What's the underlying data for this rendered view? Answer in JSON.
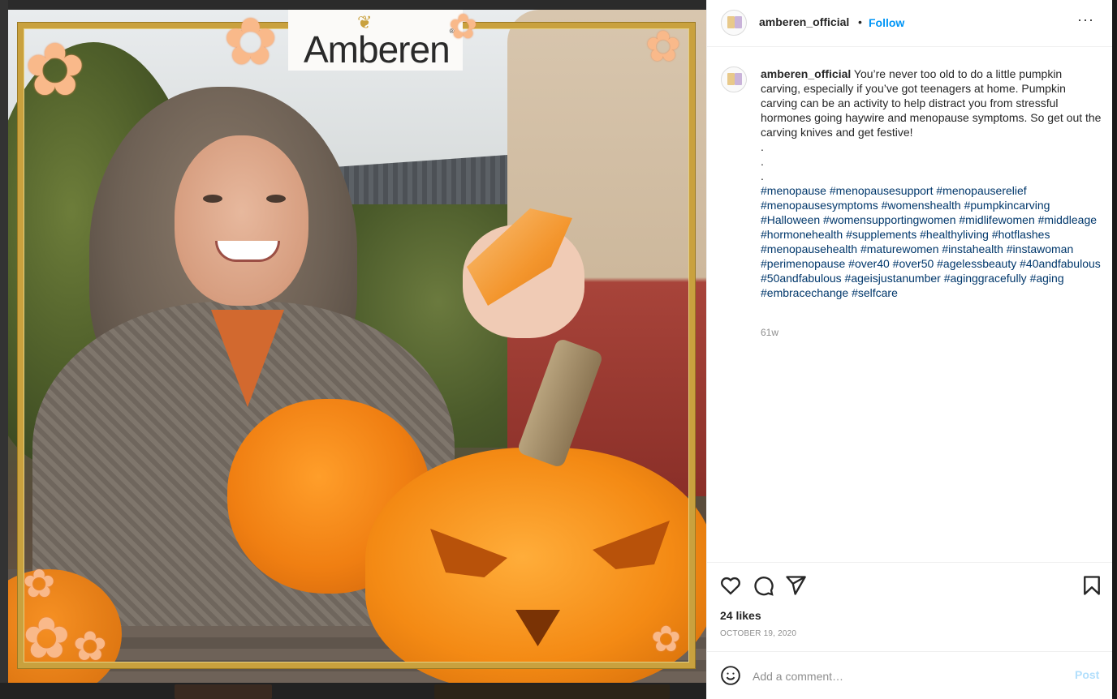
{
  "photo": {
    "brand_logo": "Amberen",
    "brand_mark": "®"
  },
  "post": {
    "username": "amberen_official",
    "separator": "•",
    "follow_label": "Follow",
    "more_label": "···",
    "caption": "You’re never too old to do a little pumpkin carving, especially if you’ve got teenagers at home. Pumpkin carving can be an activity to help distract you from stressful hormones going haywire and menopause symptoms. So get out the carving knives and get festive!",
    "dots": [
      ".",
      ".",
      "."
    ],
    "hashtags": "#menopause #menopausesupport #menopauserelief #menopausesymptoms #womenshealth #pumpkincarving #Halloween #womensupportingwomen #midlifewomen #middleage #hormonehealth #supplements #healthyliving #hotflashes #menopausehealth #maturewomen #instahealth #instawoman #perimenopause #over40 #over50 #agelessbeauty #40andfabulous #50andfabulous #ageisjustanumber #aginggracefully #aging #embracechange #selfcare",
    "time_ago": "61w",
    "likes": "24 likes",
    "date": "OCTOBER 19, 2020"
  },
  "comment": {
    "placeholder": "Add a comment…",
    "post_label": "Post"
  },
  "icons": {
    "like": "heart-icon",
    "comment": "comment-icon",
    "share": "paper-plane-icon",
    "save": "bookmark-icon",
    "emoji": "smiley-icon",
    "more": "ellipsis-icon"
  },
  "colors": {
    "link": "#0095f6",
    "hashtag": "#00376b",
    "muted": "#8e8e8e",
    "post_disabled": "#b2dffc",
    "frame_gold": "#c9a13e"
  }
}
